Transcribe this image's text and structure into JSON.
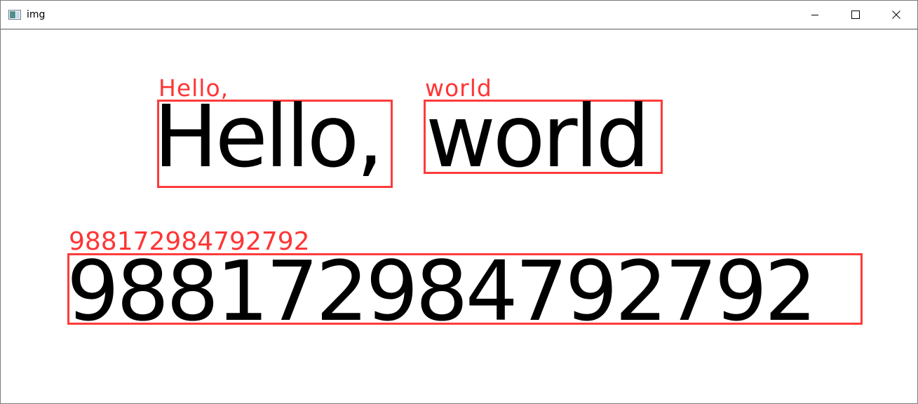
{
  "window": {
    "title": "img",
    "icon": "image-window-icon",
    "controls": {
      "minimize_icon": "minimize-icon",
      "maximize_icon": "maximize-icon",
      "close_icon": "close-icon"
    }
  },
  "detections": [
    {
      "label": "Hello,",
      "text": "Hello,"
    },
    {
      "label": "world",
      "text": "world"
    },
    {
      "label": "988172984792792",
      "text": "988172984792792"
    }
  ],
  "colors": {
    "box": "#ff3b3b",
    "label": "#ff3535",
    "text": "#000000"
  }
}
